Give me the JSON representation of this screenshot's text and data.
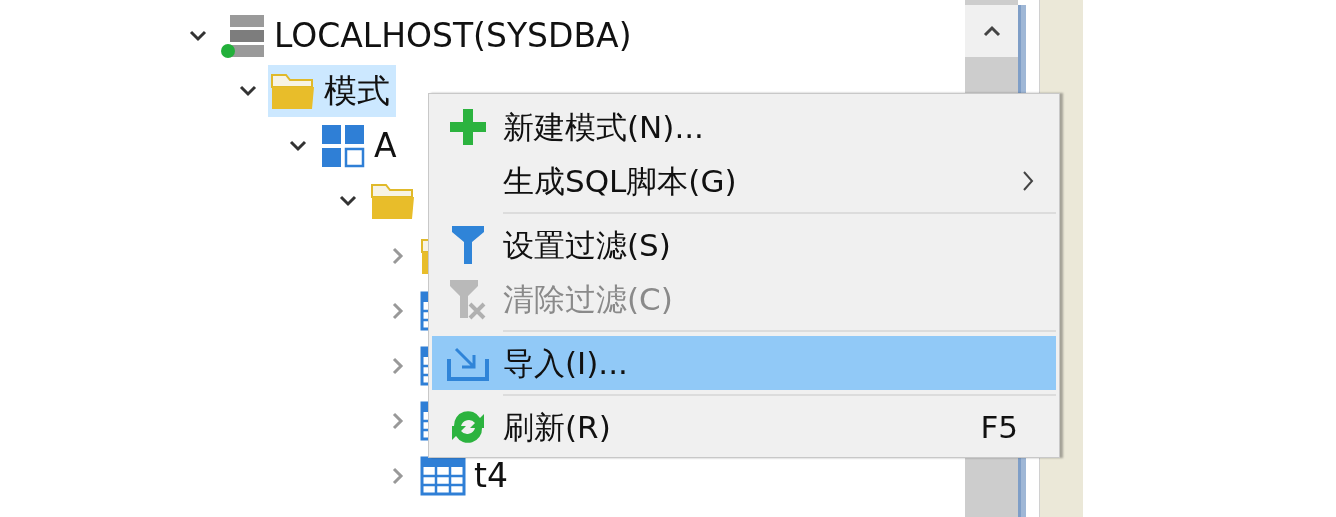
{
  "tree": [
    {
      "kind": "server",
      "label": "LOCALHOST(SYSDBA)",
      "expanded": true,
      "selected": false,
      "children": [
        {
          "kind": "folder",
          "label": "模式",
          "expanded": true,
          "selected": true,
          "children": [
            {
              "kind": "schema",
              "label": "A",
              "expanded": true,
              "selected": false,
              "children": [
                {
                  "kind": "folder",
                  "expanded": true,
                  "selected": false,
                  "children": [
                    {
                      "kind": "folder",
                      "expanded": false,
                      "selected": false
                    },
                    {
                      "kind": "table",
                      "expanded": false,
                      "selected": false
                    },
                    {
                      "kind": "table",
                      "expanded": false,
                      "selected": false
                    },
                    {
                      "kind": "table",
                      "expanded": false,
                      "selected": false
                    },
                    {
                      "kind": "table",
                      "label": "t4",
                      "expanded": false,
                      "selected": false
                    }
                  ]
                }
              ]
            }
          ]
        }
      ]
    }
  ],
  "context_menu": [
    {
      "kind": "new",
      "label": "新建模式(N)...",
      "disabled": false,
      "selected": false,
      "submenu": false
    },
    {
      "kind": "plain",
      "label": "生成SQL脚本(G)",
      "disabled": false,
      "selected": false,
      "submenu": true
    },
    {
      "kind": "separator"
    },
    {
      "kind": "filter",
      "label": "设置过滤(S)",
      "disabled": false,
      "selected": false,
      "submenu": false
    },
    {
      "kind": "clear-filter",
      "label": "清除过滤(C)",
      "disabled": true,
      "selected": false,
      "submenu": false
    },
    {
      "kind": "separator"
    },
    {
      "kind": "import",
      "label": "导入(I)...",
      "disabled": false,
      "selected": true,
      "submenu": false
    },
    {
      "kind": "separator"
    },
    {
      "kind": "refresh",
      "label": "刷新(R)",
      "shortcut": "F5",
      "disabled": false,
      "selected": false,
      "submenu": false
    }
  ]
}
